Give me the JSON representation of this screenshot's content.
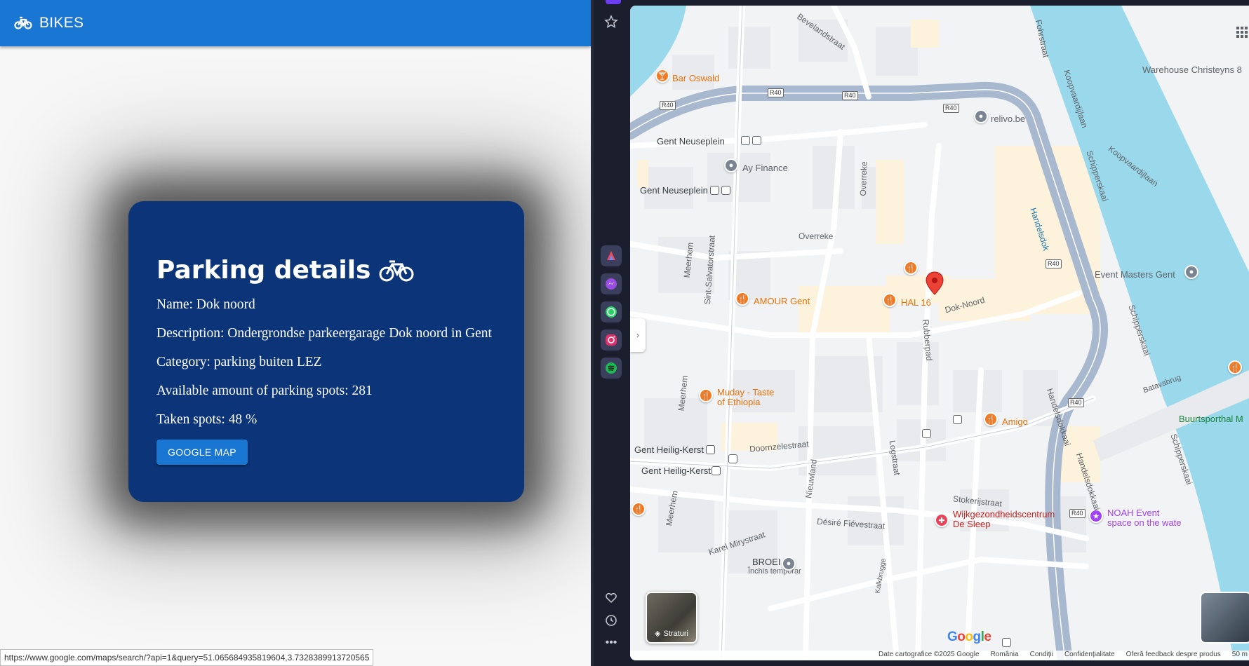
{
  "app": {
    "title": "BIKES",
    "card": {
      "heading": "Parking details",
      "name_line": "Name: Dok noord",
      "description_line": "Description: Ondergrondse parkeergarage Dok noord in Gent",
      "category_line": "Category: parking buiten LEZ",
      "available_line": "Available amount of parking spots: 281",
      "taken_line": "Taken spots: 48 %",
      "button_label": "GOOGLE MAP"
    },
    "status_url": "https://www.google.com/maps/search/?api=1&query=51.065684935819604,3.7328389913720565"
  },
  "sidebar": {
    "icons": [
      "star-icon",
      "aria-icon",
      "messenger-icon",
      "whatsapp-icon",
      "instagram-icon",
      "spotify-icon",
      "heart-icon",
      "history-icon",
      "more-icon"
    ],
    "colors": {
      "bg": "#1b1e2c",
      "messenger": "#9a4de6",
      "whatsapp": "#25d366",
      "instagram": "#e1306c",
      "spotify": "#1db954"
    }
  },
  "map": {
    "labels": {
      "bar_oswald": "Bar Oswald",
      "gent_neuseplein_1": "Gent Neuseplein",
      "gent_neuseplein_2": "Gent Neuseplein",
      "ay_finance": "Ay Finance",
      "relivo": "relivo.be",
      "warehouse": "Warehouse Christeyns 8",
      "event_masters": "Event Masters Gent",
      "amour": "AMOUR Gent",
      "hal16": "HAL 16",
      "muday_1": "Muday - Taste",
      "muday_2": "of Ethiopia",
      "amigo": "Amigo",
      "gent_heilig_kerst_1": "Gent Heilig-Kerst",
      "gent_heilig_kerst_2": "Gent Heilig-Kerst",
      "wijk_1": "Wijkgezondheidscentrum",
      "wijk_2": "De Sleep",
      "noah_1": "NOAH Event",
      "noah_2": "space on the wate",
      "broei": "BROEI",
      "broei_status": "Închis temporar",
      "buurtsporthal": "Buurtsporthal M"
    },
    "streets": {
      "bevelandstraat": "Bevelandstraat",
      "fohrstraat": "Fohrstraat",
      "koopvaardijlaan_1": "Koopvaardijlaan",
      "koopvaardijlaan_2": "Koopvaardijlaan",
      "schipperskaai_1": "Schipperskaai",
      "schipperskaai_2": "Schipperskaai",
      "schipperskaai_3": "Schipperskaai",
      "handelsdok": "Handelsdok",
      "overreke_1": "Overreke",
      "overreke_2": "Overreke",
      "meerhem_1": "Meerhem",
      "meerhem_2": "Meerhem",
      "meerhem_3": "Meerhem",
      "sint_salvatorstraat": "Sint-Salvatorstraat",
      "dok_noord": "Dok-Noord",
      "rubberpad": "Rubberpad",
      "batavabrug": "Batavabrug",
      "handelsdokkaai_1": "Handelsdokkaai",
      "handelsdokkaai_2": "Handelsdokkaai",
      "doornzelestraat": "Doornzelestraat",
      "logstraat": "Logstraat",
      "nieuwland": "Nieuwland",
      "stokerijstraat": "Stokerijstraat",
      "karel_mirystraat": "Karel Mirystraat",
      "desire_fievestraat": "Désiré Fiévestraat",
      "kalkbrugge": "Kalkbrugge",
      "r40": "R40"
    },
    "layers_label": "Straturi",
    "google": "Google",
    "attribution": [
      "Date cartografice ©2025 Google",
      "România",
      "Condiții",
      "Confidențialitate",
      "Oferă feedback despre produs",
      "50 m"
    ],
    "colors": {
      "water": "#9ad9ec",
      "ring_road": "#a8b9cf",
      "road": "#ffffff",
      "building": "#e8eaed",
      "block": "#fdf3dc",
      "marker": "#ea4335"
    }
  }
}
